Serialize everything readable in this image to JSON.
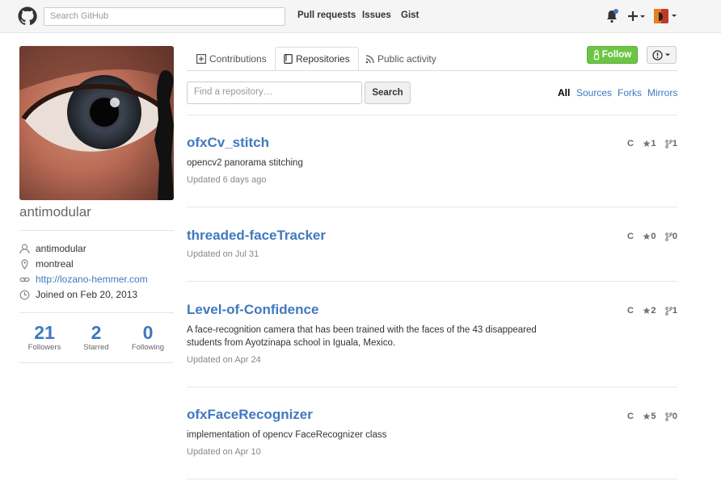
{
  "header": {
    "search_placeholder": "Search GitHub",
    "nav": [
      "Pull requests",
      "Issues",
      "Gist"
    ],
    "icons": [
      "github-logo-icon",
      "bell-icon",
      "plus-icon",
      "avatar-icon"
    ]
  },
  "profile": {
    "username": "antimodular",
    "details": {
      "name": "antimodular",
      "location": "montreal",
      "website": "http://lozano-hemmer.com",
      "joined": "Joined on Feb 20, 2013"
    },
    "stats": [
      {
        "num": "21",
        "label": "Followers"
      },
      {
        "num": "2",
        "label": "Starred"
      },
      {
        "num": "0",
        "label": "Following"
      }
    ]
  },
  "tabs": [
    "Contributions",
    "Repositories",
    "Public activity"
  ],
  "actions": {
    "follow": "Follow"
  },
  "repo_filter": {
    "placeholder": "Find a repository…",
    "search_label": "Search",
    "filters": [
      "All",
      "Sources",
      "Forks",
      "Mirrors"
    ]
  },
  "repos": [
    {
      "name": "ofxCv_stitch",
      "desc": "opencv2 panorama stitching",
      "updated": "Updated 6 days ago",
      "lang": "C",
      "stars": "1",
      "forks": "1"
    },
    {
      "name": "threaded-faceTracker",
      "desc": "",
      "updated": "Updated on Jul 31",
      "lang": "C",
      "stars": "0",
      "forks": "0"
    },
    {
      "name": "Level-of-Confidence",
      "desc": "A face-recognition camera that has been trained with the faces of the 43 disappeared students from Ayotzinapa school in Iguala, Mexico.",
      "updated": "Updated on Apr 24",
      "lang": "C",
      "stars": "2",
      "forks": "1"
    },
    {
      "name": "ofxFaceRecognizer",
      "desc": "implementation of opencv FaceRecognizer class",
      "updated": "Updated on Apr 10",
      "lang": "C",
      "stars": "5",
      "forks": "0"
    }
  ],
  "colors": {
    "link": "#4078c0",
    "follow_green": "#6cc644",
    "notification_dot": "#4078c0"
  }
}
